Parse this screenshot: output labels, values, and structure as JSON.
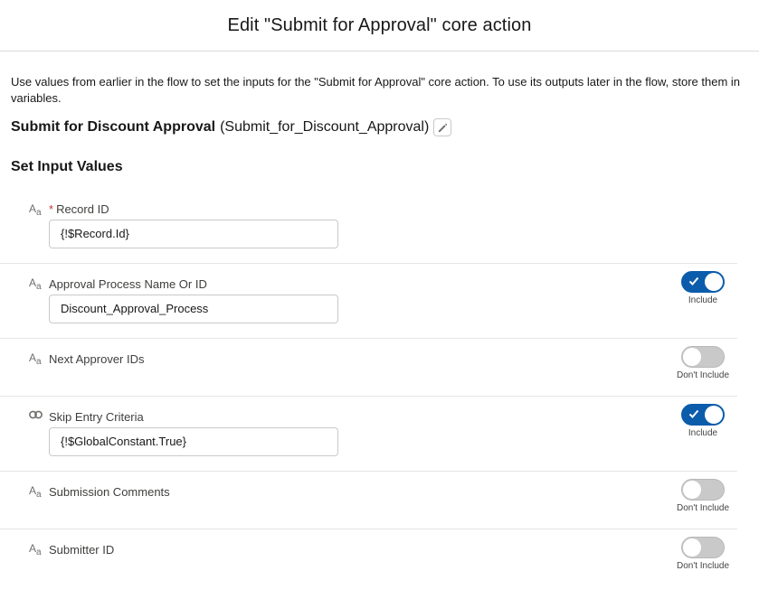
{
  "modal": {
    "title": "Edit \"Submit for Approval\" core action"
  },
  "description": "Use values from earlier in the flow to set the inputs for the \"Submit for Approval\" core action. To use its outputs later in the flow, store them in variables.",
  "action": {
    "label": "Submit for Discount Approval",
    "api_name": "(Submit_for_Discount_Approval)"
  },
  "section_title": "Set Input Values",
  "parameters": [
    {
      "label": "Record ID",
      "required": "*",
      "type_icon": "text-type-icon",
      "value": "{!$Record.Id}"
    },
    {
      "label": "Approval Process Name Or ID",
      "type_icon": "text-type-icon",
      "value": "Discount_Approval_Process",
      "toggle": "Include",
      "toggle_on": true
    },
    {
      "label": "Next Approver IDs",
      "type_icon": "text-type-icon",
      "toggle": "Don't Include",
      "toggle_on": false
    },
    {
      "label": "Skip Entry Criteria",
      "type_icon": "boolean-type-icon",
      "value": "{!$GlobalConstant.True}",
      "toggle": "Include",
      "toggle_on": true
    },
    {
      "label": "Submission Comments",
      "type_icon": "text-type-icon",
      "toggle": "Don't Include",
      "toggle_on": false
    },
    {
      "label": "Submitter ID",
      "type_icon": "text-type-icon",
      "toggle": "Don't Include",
      "toggle_on": false
    }
  ],
  "colors": {
    "toggle_on": "#0b5cab",
    "toggle_off": "#c9c9c9",
    "required": "#c23934"
  }
}
